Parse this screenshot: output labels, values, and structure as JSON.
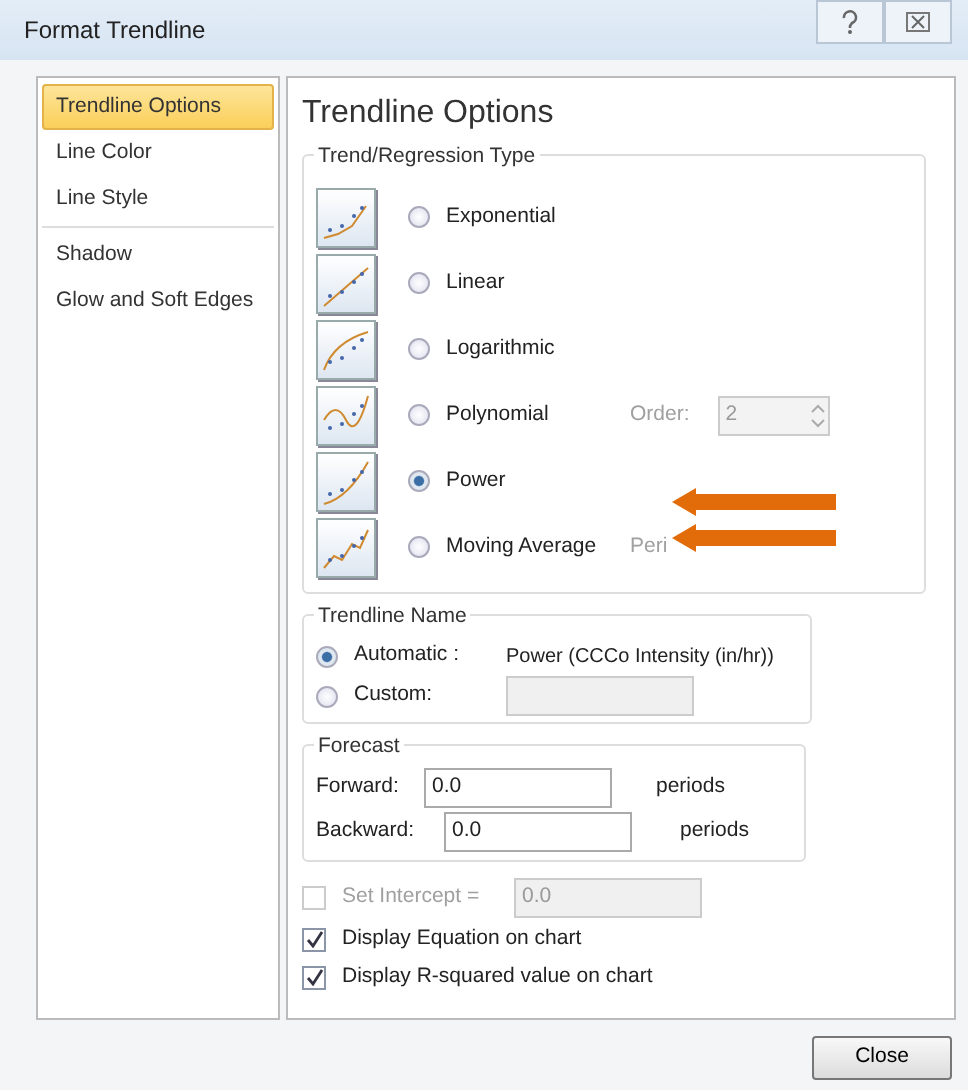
{
  "window": {
    "title": "Format Trendline"
  },
  "sidebar": {
    "items": [
      {
        "label": "Trendline Options",
        "selected": true
      },
      {
        "label": "Line Color",
        "selected": false
      },
      {
        "label": "Line Style",
        "selected": false
      },
      {
        "label": "Shadow",
        "selected": false
      },
      {
        "label": "Glow and Soft Edges",
        "selected": false
      }
    ]
  },
  "panel": {
    "title": "Trendline Options"
  },
  "regression": {
    "title": "Trend/Regression Type",
    "options": [
      {
        "kind": "exponential",
        "label": "Exponential",
        "selected": false
      },
      {
        "kind": "linear",
        "label": "Linear",
        "selected": false
      },
      {
        "kind": "logarithmic",
        "label": "Logarithmic",
        "selected": false
      },
      {
        "kind": "polynomial",
        "label": "Polynomial",
        "selected": false,
        "param": {
          "label": "Order:",
          "value": "2",
          "disabled": true
        }
      },
      {
        "kind": "power",
        "label": "Power",
        "selected": true
      },
      {
        "kind": "moving_average",
        "label": "Moving Average",
        "selected": false,
        "param": {
          "label": "Peri",
          "disabled": true
        }
      }
    ]
  },
  "trendline_name": {
    "title": "Trendline Name",
    "options": [
      {
        "kind": "automatic",
        "label": "Automatic :",
        "selected": true,
        "text": "Power (CCCo Intensity (in/hr))"
      },
      {
        "kind": "custom",
        "label": "Custom:",
        "selected": false
      }
    ]
  },
  "forecast": {
    "title": "Forecast",
    "rows": [
      {
        "label": "Forward:",
        "value": "0.0",
        "unit": "periods"
      },
      {
        "label": "Backward:",
        "value": "0.0",
        "unit": "periods"
      }
    ]
  },
  "intercept": {
    "label": "Set Intercept =",
    "checked": false,
    "disabled": true,
    "value": "0.0"
  },
  "display_options": [
    {
      "label": "Display Equation on chart",
      "checked": true
    },
    {
      "label": "Display R-squared value on chart",
      "checked": true
    }
  ],
  "buttons": [
    "Close"
  ],
  "annotations": [
    {
      "kind": "arrow"
    },
    {
      "kind": "arrow"
    }
  ]
}
